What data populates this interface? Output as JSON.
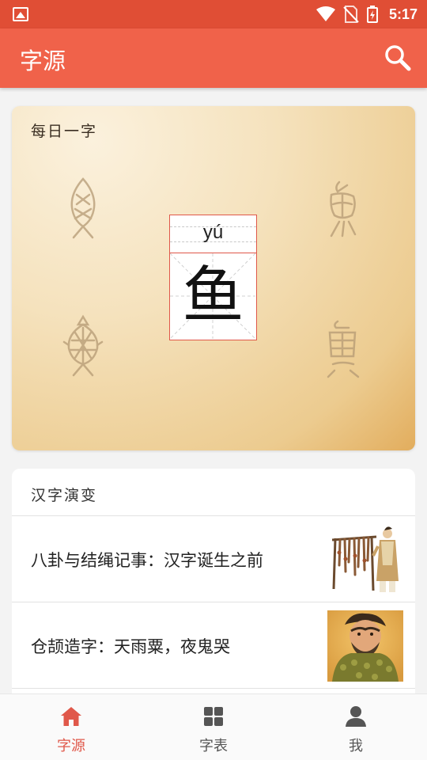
{
  "status_bar": {
    "time": "5:17"
  },
  "app_bar": {
    "title": "字源",
    "search_icon": "search-icon"
  },
  "daily_card": {
    "label": "每日一字",
    "pinyin": "yú",
    "character": "鱼"
  },
  "evolution": {
    "title": "汉字演变",
    "articles": [
      {
        "title": "八卦与结绳记事：汉字诞生之前"
      },
      {
        "title": "仓颉造字：天雨粟，夜鬼哭"
      }
    ]
  },
  "bottom_nav": {
    "items": [
      {
        "label": "字源",
        "icon": "home-icon",
        "active": true
      },
      {
        "label": "字表",
        "icon": "grid-icon",
        "active": false
      },
      {
        "label": "我",
        "icon": "person-icon",
        "active": false
      }
    ]
  },
  "colors": {
    "accent": "#f0624a",
    "status": "#e04e35",
    "active": "#e0584a"
  }
}
